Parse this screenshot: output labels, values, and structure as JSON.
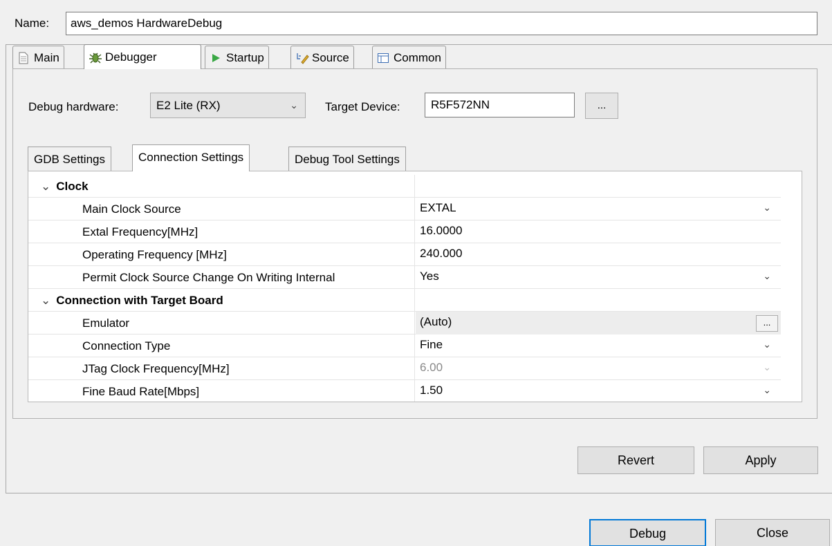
{
  "name": {
    "label": "Name:",
    "value": "aws_demos HardwareDebug"
  },
  "launch_tabs": [
    {
      "label": "Main",
      "icon": "document-icon"
    },
    {
      "label": "Debugger",
      "icon": "bug-icon",
      "active": true
    },
    {
      "label": "Startup",
      "icon": "play-icon"
    },
    {
      "label": "Source",
      "icon": "source-icon"
    },
    {
      "label": "Common",
      "icon": "table-icon"
    }
  ],
  "debugger": {
    "hardware_label": "Debug hardware:",
    "hardware_value": "E2 Lite (RX)",
    "target_label": "Target Device:",
    "target_value": "R5F572NN",
    "browse_label": "..."
  },
  "inner_tabs": [
    {
      "label": "GDB Settings"
    },
    {
      "label": "Connection Settings",
      "active": true
    },
    {
      "label": "Debug Tool Settings"
    }
  ],
  "properties": [
    {
      "type": "group",
      "name": "Clock"
    },
    {
      "type": "item",
      "name": "Main Clock Source",
      "value": "EXTAL",
      "control": "dropdown"
    },
    {
      "type": "item",
      "name": "Extal Frequency[MHz]",
      "value": "16.0000"
    },
    {
      "type": "item",
      "name": "Operating Frequency [MHz]",
      "value": "240.000"
    },
    {
      "type": "item",
      "name": "Permit Clock Source Change On Writing Internal",
      "value": "Yes",
      "control": "dropdown"
    },
    {
      "type": "group",
      "name": "Connection with Target Board"
    },
    {
      "type": "item",
      "name": "Emulator",
      "value": "(Auto)",
      "control": "browse",
      "browse_label": "..."
    },
    {
      "type": "item",
      "name": "Connection Type",
      "value": "Fine",
      "control": "dropdown"
    },
    {
      "type": "item",
      "name": "JTag Clock Frequency[MHz]",
      "value": "6.00",
      "control": "dropdown",
      "disabled": true
    },
    {
      "type": "item",
      "name": "Fine Baud Rate[Mbps]",
      "value": "1.50",
      "control": "dropdown"
    }
  ],
  "buttons": {
    "revert": "Revert",
    "apply": "Apply",
    "debug": "Debug",
    "close": "Close"
  }
}
